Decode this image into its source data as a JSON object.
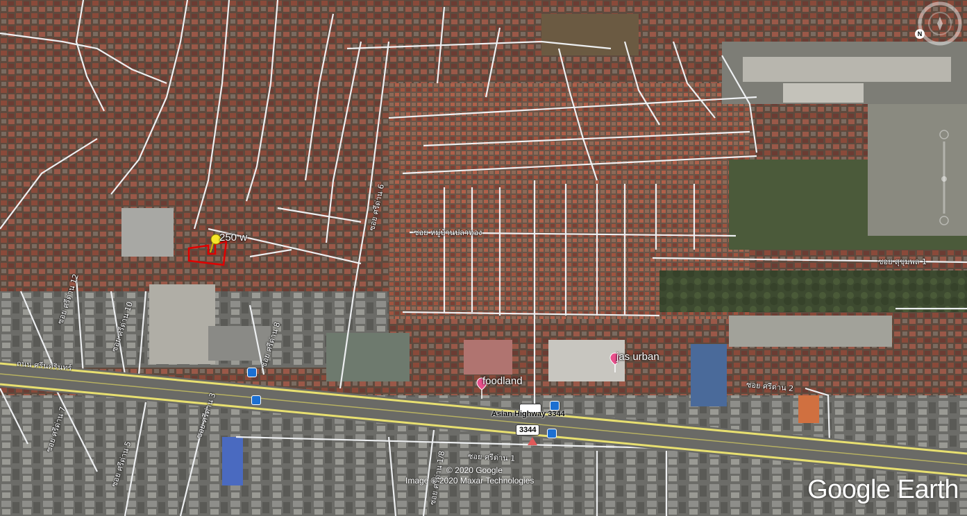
{
  "map": {
    "marker_label": "250 w",
    "places": [
      {
        "name": "jas urban"
      },
      {
        "name": "foodland"
      }
    ],
    "highway": {
      "name": "Asian Highway 3344",
      "shield": "3344"
    },
    "roads": [
      "ถนน ศรีนครินทร์",
      "ซอย ศรีด่าน 1",
      "ซอย ศรีด่าน 2",
      "ซอย ศรีด่าน 3",
      "ซอย ศรีด่าน 5",
      "ซอย ศรีด่าน 6",
      "ซอย ศรีด่าน 7",
      "ซอย ศรีด่าน 8",
      "ซอย ศรีด่าน 10",
      "ซอย ศรีด่าน 12",
      "ซอย หมู่บ้านปลาทอง",
      "ซอย สุขุมพล 1",
      "ซอย ศรีด่าน 1/8"
    ],
    "copyright": [
      "© 2020 Google",
      "Image © 2020 Maxar Technologies"
    ],
    "brand": "Google Earth",
    "compass_letter": "N",
    "icons": [
      "placemark-pin-icon",
      "pink-pin-icon",
      "compass-icon",
      "zoom-slider-icon",
      "transit-icon"
    ]
  }
}
